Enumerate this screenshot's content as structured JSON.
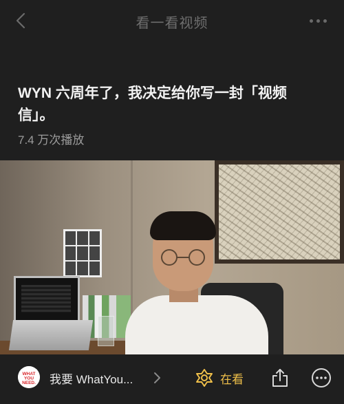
{
  "header": {
    "title": "看一看视频",
    "back_icon": "chevron-left-icon",
    "more_icon": "more-dots-icon"
  },
  "post": {
    "title": "WYN 六周年了，我决定给你写一封「视频信」。",
    "play_count": "7.4 万次播放"
  },
  "footer": {
    "account_logo_text": "WHAT YOU NEED.",
    "account_name": "我要 WhatYou...",
    "watch_label": "在看",
    "watch_color": "#f0c04a",
    "share_icon": "share-icon",
    "more_icon": "more-circle-icon"
  }
}
